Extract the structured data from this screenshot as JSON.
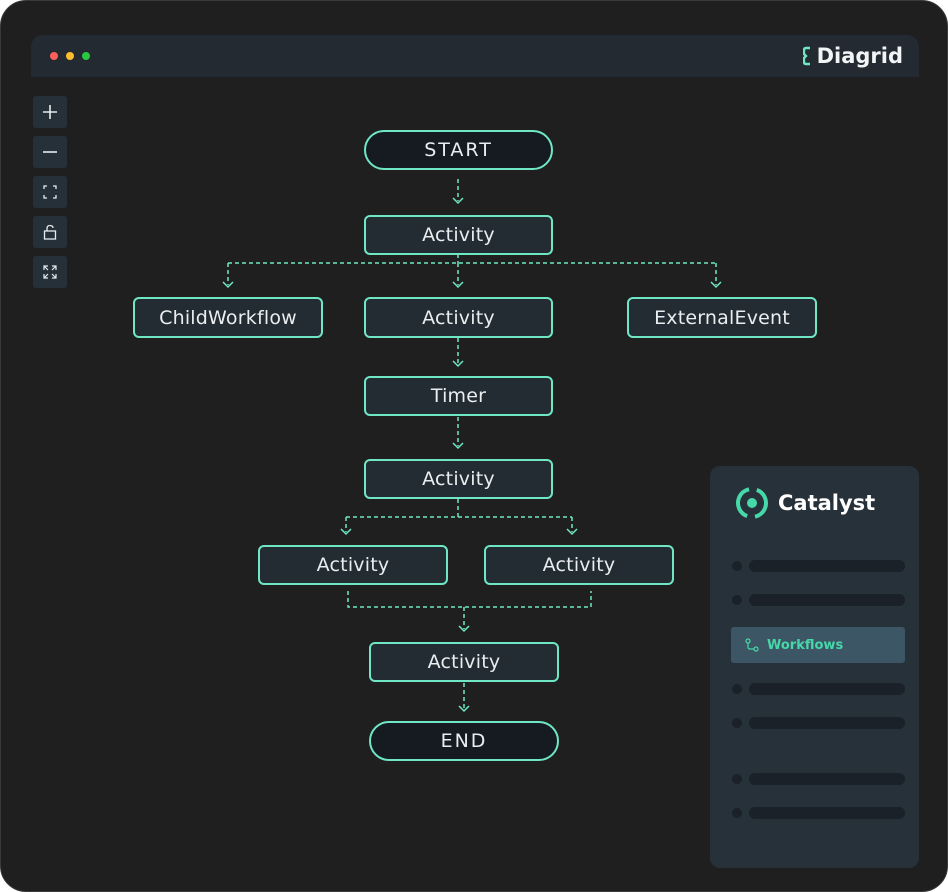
{
  "window": {
    "brand": "Diagrid",
    "traffic_lights": [
      "#ff5f57",
      "#febc2e",
      "#28c840"
    ]
  },
  "toolbar": {
    "tools": [
      {
        "name": "zoom-in",
        "icon": "plus-icon"
      },
      {
        "name": "zoom-out",
        "icon": "minus-icon"
      },
      {
        "name": "fit-view",
        "icon": "fit-icon"
      },
      {
        "name": "lock",
        "icon": "unlock-icon"
      },
      {
        "name": "expand",
        "icon": "expand-icon"
      }
    ]
  },
  "diagram": {
    "nodes": {
      "start": "START",
      "activity_1": "Activity",
      "child_workflow": "ChildWorkflow",
      "activity_2": "Activity",
      "external_event": "ExternalEvent",
      "timer": "Timer",
      "activity_3": "Activity",
      "activity_4": "Activity",
      "activity_5": "Activity",
      "activity_6": "Activity",
      "end": "END"
    },
    "edges": [
      [
        "start",
        "activity_1"
      ],
      [
        "activity_1",
        "child_workflow"
      ],
      [
        "activity_1",
        "activity_2"
      ],
      [
        "activity_1",
        "external_event"
      ],
      [
        "activity_2",
        "timer"
      ],
      [
        "timer",
        "activity_3"
      ],
      [
        "activity_3",
        "activity_4"
      ],
      [
        "activity_3",
        "activity_5"
      ],
      [
        "activity_4",
        "activity_6"
      ],
      [
        "activity_5",
        "activity_6"
      ],
      [
        "activity_6",
        "end"
      ]
    ],
    "accent_color": "#6fe7c4"
  },
  "sidebar": {
    "logo_text": "Catalyst",
    "selected_item": "Workflows",
    "accent_color": "#46d8a8"
  }
}
